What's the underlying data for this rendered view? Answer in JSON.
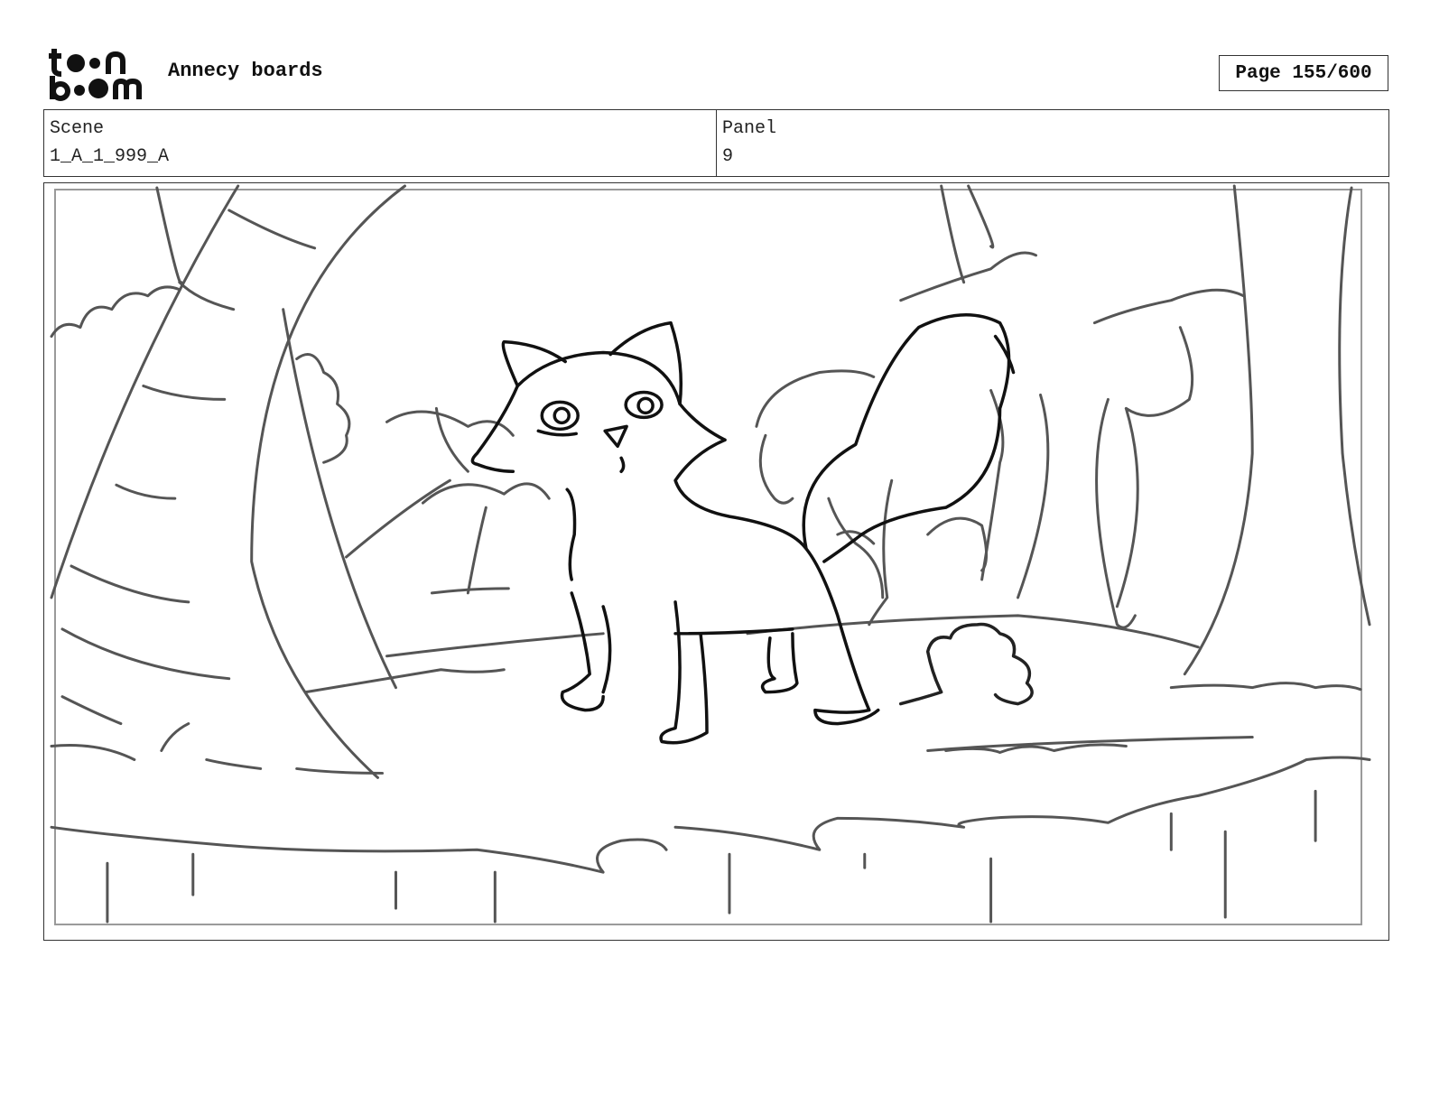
{
  "header": {
    "logo_text_line1": "toon",
    "logo_text_line2": "boom",
    "project_title": "Annecy boards",
    "page_indicator": "Page 155/600"
  },
  "info": {
    "scene_label": "Scene",
    "scene_value": "1_A_1_999_A",
    "panel_label": "Panel",
    "panel_value": "9"
  }
}
